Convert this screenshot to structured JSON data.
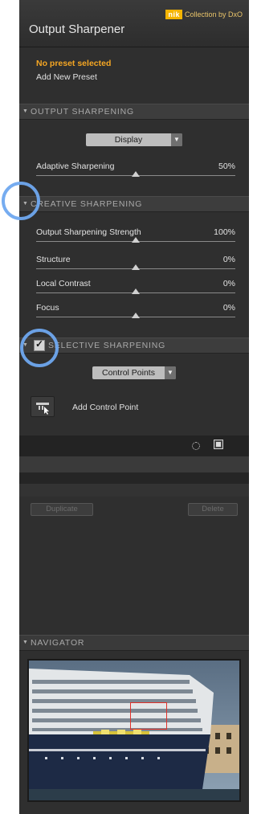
{
  "header": {
    "brand_logo": "nik",
    "brand_text": "Collection by DxO",
    "title": "Output Sharpener"
  },
  "preset": {
    "status": "No preset selected",
    "add_label": "Add New Preset"
  },
  "output_sharpening": {
    "label": "OUTPUT SHARPENING",
    "mode_dropdown": "Display",
    "adaptive": {
      "label": "Adaptive Sharpening",
      "value": "50%"
    }
  },
  "creative_sharpening": {
    "label": "CREATIVE SHARPENING",
    "sliders": [
      {
        "label": "Output Sharpening Strength",
        "value": "100%"
      },
      {
        "label": "Structure",
        "value": "0%"
      },
      {
        "label": "Local Contrast",
        "value": "0%"
      },
      {
        "label": "Focus",
        "value": "0%"
      }
    ]
  },
  "selective_sharpening": {
    "label": "SELECTIVE SHARPENING",
    "checkbox_mark": "✓",
    "dropdown": "Control Points",
    "add_control_point": "Add Control Point",
    "duplicate": "Duplicate",
    "delete": "Delete"
  },
  "navigator": {
    "label": "NAVIGATOR"
  },
  "icons": {
    "collapse": "▼",
    "dropdown_arrow": "▼"
  },
  "colors": {
    "accent_orange": "#f5a623",
    "highlight_blue": "#6fa8ef",
    "nav_rect": "#e0312a"
  }
}
